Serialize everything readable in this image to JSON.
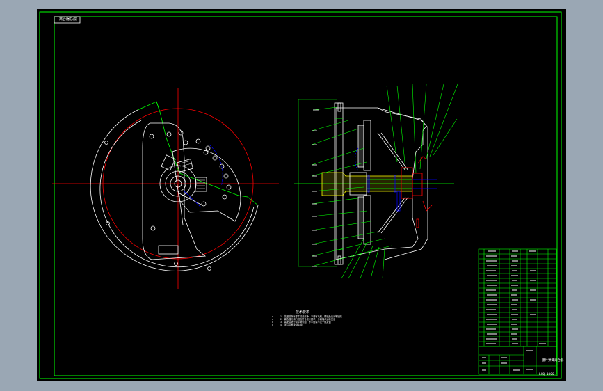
{
  "drawing": {
    "label": "离合器总成",
    "title_name": "膜片弹簧离合器",
    "number": "LHQ-1000",
    "notes_heading": "技术要求",
    "notes": [
      "1. 装配前所有零件清洗干净，不得有毛刺、锈蚀及油污等缺陷",
      "2. 离合器分离行程应符合设计要求，分离轴承运转灵活",
      "3. 装配后进行动平衡试验，不平衡量不大于规定值",
      "4. 未注公差按GB1804"
    ]
  },
  "colors": {
    "background": "#000000",
    "frame": "#00ff00",
    "outline": "#ffffff",
    "centerline": "#ff0000",
    "hidden": "#0000ff",
    "leader": "#00ff00"
  }
}
